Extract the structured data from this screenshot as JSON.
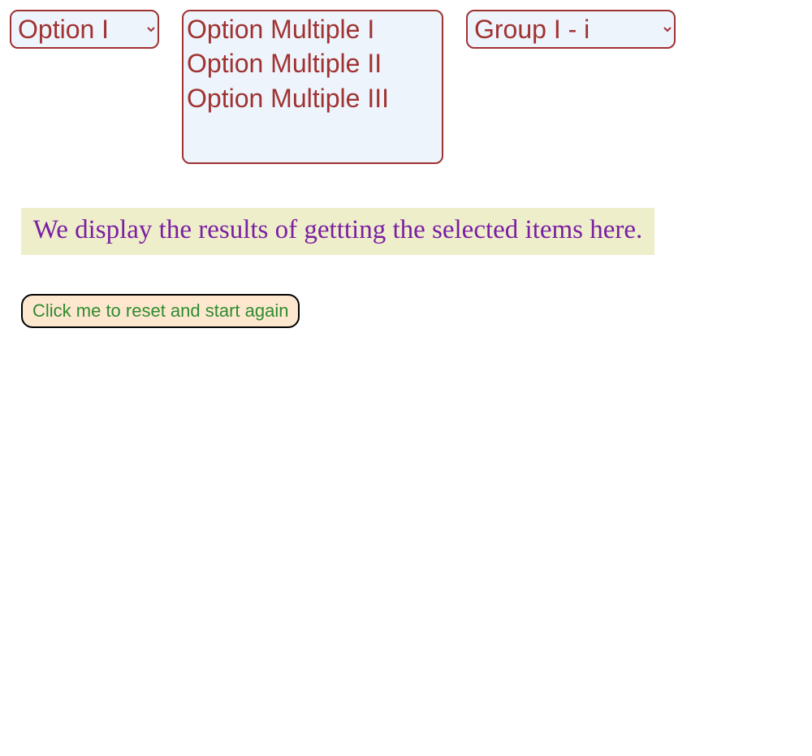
{
  "selects": {
    "single": {
      "selected": "Option I",
      "options": [
        "Option I"
      ]
    },
    "multiple": {
      "options": [
        "Option Multiple I",
        "Option Multiple II",
        "Option Multiple III"
      ]
    },
    "group": {
      "selected": "Group I - i",
      "options": [
        "Group I - i"
      ]
    }
  },
  "results": {
    "text": "We display the results of gettting the selected items here."
  },
  "reset_button": {
    "label": "Click me to reset and start again"
  }
}
